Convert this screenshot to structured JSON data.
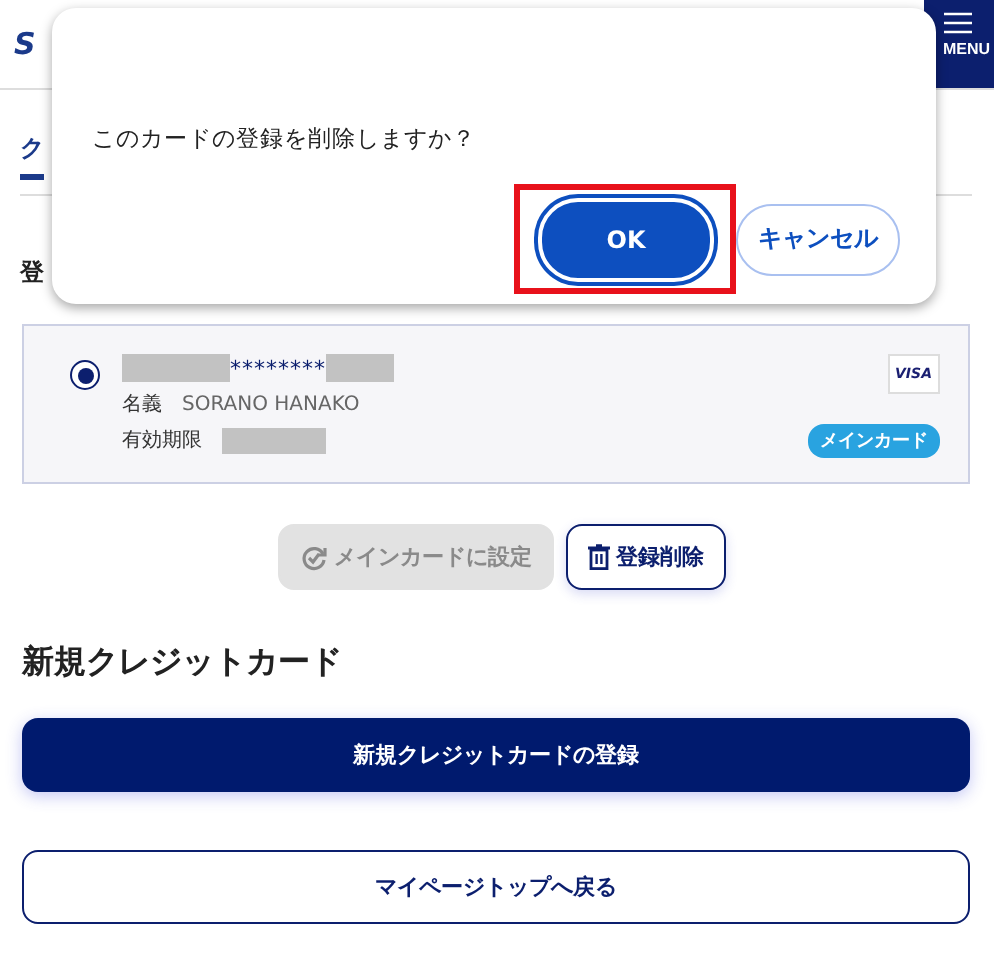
{
  "header": {
    "logo": "S",
    "menu_label": "MENU"
  },
  "page_title": "ク",
  "section_title": "登",
  "card": {
    "selected": true,
    "number_mask": "********",
    "holder_label": "名義",
    "holder": "SORANO HANAKO",
    "expiry_label": "有効期限",
    "brand": "VISA",
    "badge": "メインカード"
  },
  "card_actions": [
    {
      "label": "メインカードに設定",
      "kind": "set-main",
      "disabled": true
    },
    {
      "label": "登録削除",
      "kind": "delete",
      "disabled": false
    }
  ],
  "new_section": {
    "title": "新規クレジットカード",
    "button": "新規クレジットカードの登録"
  },
  "back_button": "マイページトップへ戻る",
  "dialog": {
    "message": "このカードの登録を削除しますか？",
    "buttons": [
      {
        "label": "OK",
        "kind": "primary",
        "highlighted": true
      },
      {
        "label": "キャンセル",
        "kind": "secondary",
        "highlighted": false
      }
    ]
  }
}
